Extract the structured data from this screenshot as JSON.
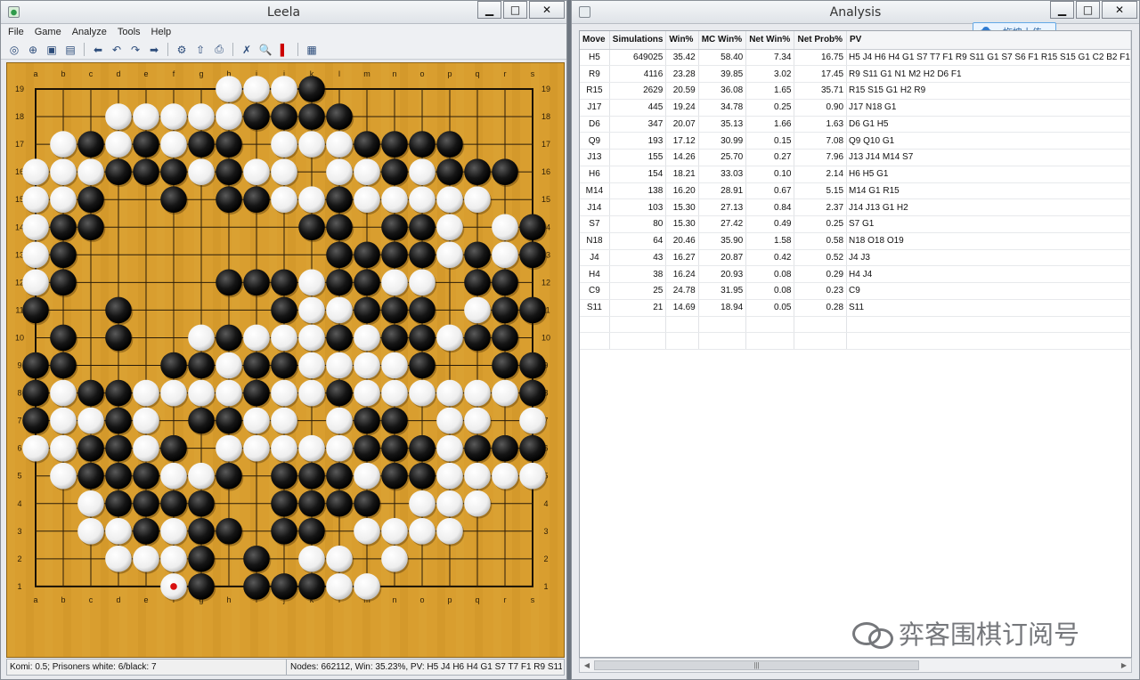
{
  "leela_window": {
    "title": "Leela",
    "menu": [
      "File",
      "Game",
      "Analyze",
      "Tools",
      "Help"
    ],
    "toolbar_icons": [
      "new-game-icon",
      "open-file-icon",
      "save-file-icon",
      "back-icon",
      "undo-icon",
      "redo-icon",
      "forward-icon",
      "settings-icon",
      "pass-icon",
      "print-icon",
      "resign-icon",
      "analyze-icon",
      "stop-icon",
      "engine-icon"
    ],
    "status_left": "Komi: 0.5; Prisoners white: 6/black: 7",
    "status_right": "Nodes: 662112, Win: 35.23%, PV: H5 J4 H6 H4 G1 S7 T7 F1 R9 S11",
    "board": {
      "letters": [
        "a",
        "b",
        "c",
        "d",
        "e",
        "f",
        "g",
        "h",
        "i",
        "j",
        "k",
        "l",
        "m",
        "n",
        "o",
        "p",
        "q",
        "r",
        "s"
      ],
      "numbers": [
        "19",
        "18",
        "17",
        "16",
        "15",
        "14",
        "13",
        "12",
        "11",
        "10",
        "9",
        "8",
        "7",
        "6",
        "5",
        "4",
        "3",
        "2",
        "1"
      ],
      "rows": [
        ".......WWWB........",
        "...WWWWWBBBB.......",
        ".WBWBWBB.WWWBBBB...",
        "WWWBBBWBWW.WWBWBBB.",
        "WWB..B.BBWWBWWWWW..",
        "WBB.......BB.BBW.WB",
        "WB.........BBBBWBWB",
        "WB.....BBBWBBWW.BB.",
        "B..B.....BWWBBB.WBB",
        ".B.B..WBWWWBWBBWBB.",
        "BB...BBWBBWWWWB..BB",
        "BWBBWWWWBWWBWWWWWWB",
        "BWWBW.BBWW.WBB.WW.W",
        "WWBBWB.WWWWWBBBWBBB",
        ".WBBBWWB.BBBWBBWWWW",
        "..WBBBB..BBBB.WWW..",
        "..WWBWBB.BB.WWWW...",
        "...WWWB.B.WW.W.....",
        ".....WB.BBBWW......"
      ],
      "last_move": [
        0,
        5
      ]
    }
  },
  "analysis_window": {
    "title": "Analysis",
    "upload_label": "拖拽上传",
    "columns": [
      "Move",
      "Simulations",
      "Win%",
      "MC Win%",
      "Net Win%",
      "Net Prob%",
      "PV"
    ],
    "rows": [
      [
        "H5",
        "649025",
        "35.42",
        "58.40",
        "7.34",
        "16.75",
        "H5 J4 H6 H4 G1 S7 T7 F1 R9 S11 G1 S7 S6 F1 R15 S15 G1 C2 B2 F1"
      ],
      [
        "R9",
        "4116",
        "23.28",
        "39.85",
        "3.02",
        "17.45",
        "R9 S11 G1 N1 M2 H2 D6 F1"
      ],
      [
        "R15",
        "2629",
        "20.59",
        "36.08",
        "1.65",
        "35.71",
        "R15 S15 G1 H2 R9"
      ],
      [
        "J17",
        "445",
        "19.24",
        "34.78",
        "0.25",
        "0.90",
        "J17 N18 G1"
      ],
      [
        "D6",
        "347",
        "20.07",
        "35.13",
        "1.66",
        "1.63",
        "D6 G1 H5"
      ],
      [
        "Q9",
        "193",
        "17.12",
        "30.99",
        "0.15",
        "7.08",
        "Q9 Q10 G1"
      ],
      [
        "J13",
        "155",
        "14.26",
        "25.70",
        "0.27",
        "7.96",
        "J13 J14 M14 S7"
      ],
      [
        "H6",
        "154",
        "18.21",
        "33.03",
        "0.10",
        "2.14",
        "H6 H5 G1"
      ],
      [
        "M14",
        "138",
        "16.20",
        "28.91",
        "0.67",
        "5.15",
        "M14 G1 R15"
      ],
      [
        "J14",
        "103",
        "15.30",
        "27.13",
        "0.84",
        "2.37",
        "J14 J13 G1 H2"
      ],
      [
        "S7",
        "80",
        "15.30",
        "27.42",
        "0.49",
        "0.25",
        "S7 G1"
      ],
      [
        "N18",
        "64",
        "20.46",
        "35.90",
        "1.58",
        "0.58",
        "N18 O18 O19"
      ],
      [
        "J4",
        "43",
        "16.27",
        "20.87",
        "0.42",
        "0.52",
        "J4 J3"
      ],
      [
        "H4",
        "38",
        "16.24",
        "20.93",
        "0.08",
        "0.29",
        "H4 J4"
      ],
      [
        "C9",
        "25",
        "24.78",
        "31.95",
        "0.08",
        "0.23",
        "C9"
      ],
      [
        "S11",
        "21",
        "14.69",
        "18.94",
        "0.05",
        "0.28",
        "S11"
      ]
    ]
  },
  "watermark": {
    "text": "弈客围棋订阅号"
  }
}
